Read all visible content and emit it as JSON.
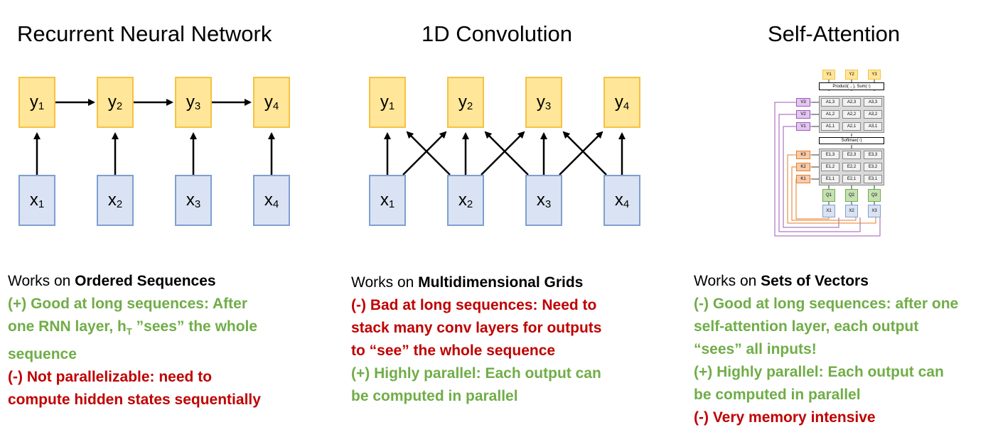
{
  "titles": {
    "rnn": "Recurrent Neural Network",
    "conv": "1D Convolution",
    "attn": "Self-Attention"
  },
  "nodes": {
    "y_letter": "y",
    "x_letter": "x",
    "indices": [
      "1",
      "2",
      "3",
      "4"
    ]
  },
  "rnn_text": {
    "intro": "Works on ",
    "intro_bold": "Ordered Sequences",
    "pro_line1": "(+) Good at long sequences: After",
    "pro_line2a": "one RNN layer, h",
    "pro_line2_sub": "T",
    "pro_line2b": " ”sees” the whole",
    "pro_line3": "sequence",
    "con_line1": "(-) Not parallelizable: need to",
    "con_line2": "compute hidden states sequentially"
  },
  "conv_text": {
    "intro": "Works on ",
    "intro_bold": "Multidimensional Grids",
    "con_line1": "(-) Bad at long sequences: Need to",
    "con_line2": "stack many conv layers for outputs",
    "con_line3": "to “see” the whole sequence",
    "pro_line1": "(+) Highly parallel: Each output can",
    "pro_line2": "be computed in parallel"
  },
  "attn_text": {
    "intro": "Works on ",
    "intro_bold": "Sets of Vectors",
    "pro1_line1": "(-) Good at long sequences: after one",
    "pro1_line2": "self-attention layer, each output",
    "pro1_line3": "“sees” all inputs!",
    "pro2_line1": "(+) Highly parallel: Each output can",
    "pro2_line2": "be computed in parallel",
    "con_line1": "(-) Very memory intensive"
  },
  "attn_diagram": {
    "outputs": [
      "Y1",
      "Y2",
      "Y3"
    ],
    "product_label": "Product(→), Sum(↑)",
    "values": [
      "V3",
      "V2",
      "V1"
    ],
    "a_matrix": [
      [
        "A1,3",
        "A2,3",
        "A3,3"
      ],
      [
        "A1,2",
        "A2,2",
        "A3,2"
      ],
      [
        "A1,1",
        "A2,1",
        "A3,1"
      ]
    ],
    "softmax_label": "Softmax(↑)",
    "keys": [
      "K3",
      "K2",
      "K1"
    ],
    "e_matrix": [
      [
        "E1,3",
        "E2,3",
        "E3,3"
      ],
      [
        "E1,2",
        "E2,2",
        "E3,2"
      ],
      [
        "E1,1",
        "E2,1",
        "E3,1"
      ]
    ],
    "queries": [
      "Q1",
      "Q2",
      "Q3"
    ],
    "inputs": [
      "X1",
      "X2",
      "X3"
    ]
  },
  "colors": {
    "good": "#70ad47",
    "bad": "#c00000",
    "y_fill": "#ffe699",
    "x_fill": "#dae3f3"
  }
}
